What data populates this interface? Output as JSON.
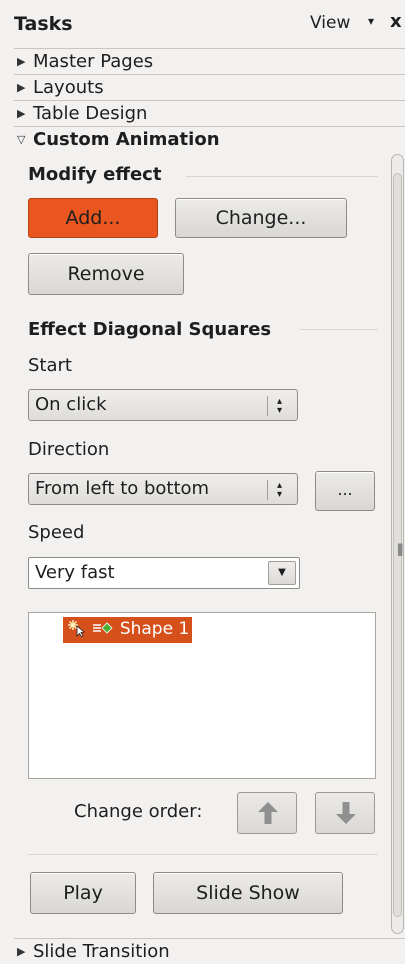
{
  "header": {
    "title": "Tasks",
    "view_label": "View",
    "view_caret": "▾",
    "close_label": "x"
  },
  "decks": [
    {
      "label": "Master Pages",
      "expanded": false,
      "tri": "▶"
    },
    {
      "label": "Layouts",
      "expanded": false,
      "tri": "▶"
    },
    {
      "label": "Table Design",
      "expanded": false,
      "tri": "▶"
    },
    {
      "label": "Custom Animation",
      "expanded": true,
      "tri": "▽"
    },
    {
      "label": "Slide Transition",
      "expanded": false,
      "tri": "▶"
    }
  ],
  "modify_effect": {
    "title": "Modify effect",
    "add_label": "Add...",
    "change_label": "Change...",
    "remove_label": "Remove"
  },
  "effect": {
    "title": "Effect Diagonal Squares",
    "start_label": "Start",
    "start_value": "On click",
    "direction_label": "Direction",
    "direction_value": "From left to bottom",
    "options_label": "...",
    "speed_label": "Speed",
    "speed_value": "Very fast"
  },
  "effects_list": {
    "items": [
      {
        "label": "Shape 1"
      }
    ]
  },
  "change_order": {
    "label": "Change order:"
  },
  "actions": {
    "play_label": "Play",
    "slideshow_label": "Slide Show"
  },
  "colors": {
    "accent": "#e9561f",
    "selection": "#d6501b"
  }
}
